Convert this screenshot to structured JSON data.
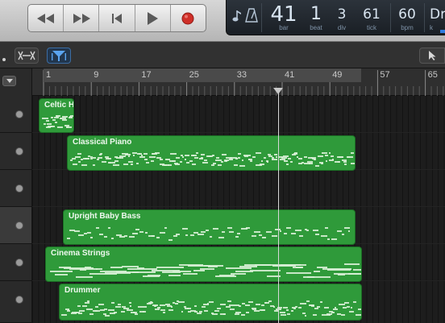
{
  "lcd": {
    "bar": "41",
    "bar_label": "bar",
    "beat": "1",
    "beat_label": "beat",
    "div": "3",
    "div_label": "div",
    "tick": "61",
    "tick_label": "tick",
    "tempo": "60",
    "tempo_label": "bpm",
    "key_partial": "Dr",
    "key_label_partial": "k"
  },
  "ruler": {
    "marks": [
      "1",
      "9",
      "17",
      "25",
      "33",
      "41",
      "49",
      "57",
      "65"
    ]
  },
  "tracks": [
    {
      "region": "Celtic H"
    },
    {
      "region": "Classical Piano"
    },
    {
      "region": ""
    },
    {
      "region": "Upright Baby Bass"
    },
    {
      "region": "Cinema Strings"
    },
    {
      "region": "Drummer"
    }
  ],
  "colors": {
    "region_green": "#2f9a3a",
    "lcd_background": "#1f252c",
    "record_red": "#d0302a"
  },
  "icons": [
    "rewind-icon",
    "fast-forward-icon",
    "go-to-start-icon",
    "play-icon",
    "record-icon",
    "tuner-icon",
    "metronome-icon",
    "flex-icon",
    "catch-icon",
    "pointer-tool-icon",
    "track-menu-icon"
  ]
}
